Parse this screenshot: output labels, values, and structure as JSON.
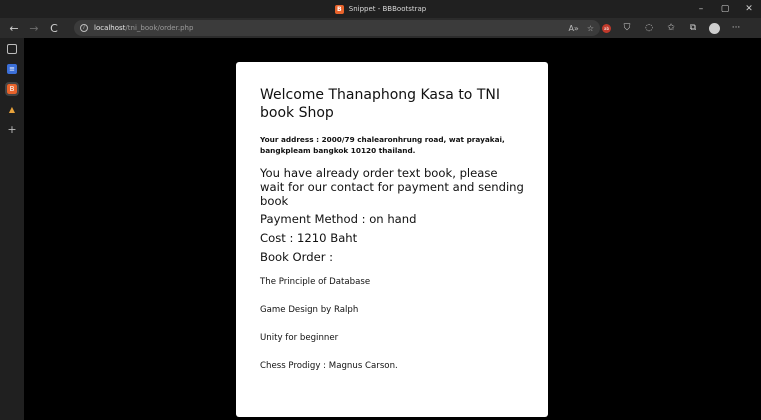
{
  "window": {
    "title": "Snippet - BBBootstrap",
    "controls": {
      "minimize": "–",
      "maximize": "▢",
      "close": "✕"
    }
  },
  "toolbar": {
    "back_icon": "←",
    "forward_icon": "→",
    "refresh_icon": "C",
    "url_host": "localhost",
    "url_path": "/tni_book/order.php",
    "more_icon": "···"
  },
  "content": {
    "welcome": "Welcome Thanaphong Kasa to TNI book Shop",
    "address": "Your address : 2000/79 chalearonhrung road, wat prayakai, bangkpleam bangkok 10120 thailand.",
    "notice": "You have already order text book, please wait for our contact for payment and sending book",
    "payment": "Payment Method : on hand",
    "cost": "Cost : 1210 Baht",
    "book_order_label": "Book Order :",
    "books": [
      "The Principle of Database",
      "Game Design by Ralph",
      "Unity for beginner",
      "Chess Prodigy : Magnus Carson."
    ]
  },
  "colors": {
    "accent": "#e8632b",
    "chrome_dark": "#202020",
    "toolbar": "#2b2b2b",
    "page_bg": "#000000",
    "card_bg": "#ffffff"
  },
  "icons": {
    "site_favicon": "bbbootstrap-icon",
    "read_aloud": "read-aloud-icon",
    "favorites": "add-favorite-icon",
    "extension": "extension-badge-icon",
    "shield": "shield-icon",
    "copilot": "circle-icon",
    "favorites_bar": "favorites-icon",
    "collections": "collections-icon",
    "profile": "profile-avatar"
  }
}
